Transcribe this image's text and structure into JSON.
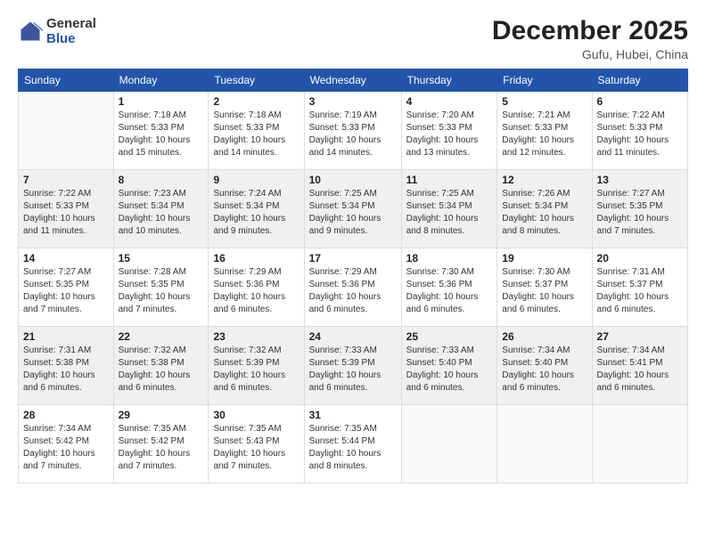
{
  "header": {
    "logo_general": "General",
    "logo_blue": "Blue",
    "month": "December 2025",
    "location": "Gufu, Hubei, China"
  },
  "columns": [
    "Sunday",
    "Monday",
    "Tuesday",
    "Wednesday",
    "Thursday",
    "Friday",
    "Saturday"
  ],
  "weeks": [
    [
      {
        "day": "",
        "info": ""
      },
      {
        "day": "1",
        "info": "Sunrise: 7:18 AM\nSunset: 5:33 PM\nDaylight: 10 hours\nand 15 minutes."
      },
      {
        "day": "2",
        "info": "Sunrise: 7:18 AM\nSunset: 5:33 PM\nDaylight: 10 hours\nand 14 minutes."
      },
      {
        "day": "3",
        "info": "Sunrise: 7:19 AM\nSunset: 5:33 PM\nDaylight: 10 hours\nand 14 minutes."
      },
      {
        "day": "4",
        "info": "Sunrise: 7:20 AM\nSunset: 5:33 PM\nDaylight: 10 hours\nand 13 minutes."
      },
      {
        "day": "5",
        "info": "Sunrise: 7:21 AM\nSunset: 5:33 PM\nDaylight: 10 hours\nand 12 minutes."
      },
      {
        "day": "6",
        "info": "Sunrise: 7:22 AM\nSunset: 5:33 PM\nDaylight: 10 hours\nand 11 minutes."
      }
    ],
    [
      {
        "day": "7",
        "info": "Sunrise: 7:22 AM\nSunset: 5:33 PM\nDaylight: 10 hours\nand 11 minutes."
      },
      {
        "day": "8",
        "info": "Sunrise: 7:23 AM\nSunset: 5:34 PM\nDaylight: 10 hours\nand 10 minutes."
      },
      {
        "day": "9",
        "info": "Sunrise: 7:24 AM\nSunset: 5:34 PM\nDaylight: 10 hours\nand 9 minutes."
      },
      {
        "day": "10",
        "info": "Sunrise: 7:25 AM\nSunset: 5:34 PM\nDaylight: 10 hours\nand 9 minutes."
      },
      {
        "day": "11",
        "info": "Sunrise: 7:25 AM\nSunset: 5:34 PM\nDaylight: 10 hours\nand 8 minutes."
      },
      {
        "day": "12",
        "info": "Sunrise: 7:26 AM\nSunset: 5:34 PM\nDaylight: 10 hours\nand 8 minutes."
      },
      {
        "day": "13",
        "info": "Sunrise: 7:27 AM\nSunset: 5:35 PM\nDaylight: 10 hours\nand 7 minutes."
      }
    ],
    [
      {
        "day": "14",
        "info": "Sunrise: 7:27 AM\nSunset: 5:35 PM\nDaylight: 10 hours\nand 7 minutes."
      },
      {
        "day": "15",
        "info": "Sunrise: 7:28 AM\nSunset: 5:35 PM\nDaylight: 10 hours\nand 7 minutes."
      },
      {
        "day": "16",
        "info": "Sunrise: 7:29 AM\nSunset: 5:36 PM\nDaylight: 10 hours\nand 6 minutes."
      },
      {
        "day": "17",
        "info": "Sunrise: 7:29 AM\nSunset: 5:36 PM\nDaylight: 10 hours\nand 6 minutes."
      },
      {
        "day": "18",
        "info": "Sunrise: 7:30 AM\nSunset: 5:36 PM\nDaylight: 10 hours\nand 6 minutes."
      },
      {
        "day": "19",
        "info": "Sunrise: 7:30 AM\nSunset: 5:37 PM\nDaylight: 10 hours\nand 6 minutes."
      },
      {
        "day": "20",
        "info": "Sunrise: 7:31 AM\nSunset: 5:37 PM\nDaylight: 10 hours\nand 6 minutes."
      }
    ],
    [
      {
        "day": "21",
        "info": "Sunrise: 7:31 AM\nSunset: 5:38 PM\nDaylight: 10 hours\nand 6 minutes."
      },
      {
        "day": "22",
        "info": "Sunrise: 7:32 AM\nSunset: 5:38 PM\nDaylight: 10 hours\nand 6 minutes."
      },
      {
        "day": "23",
        "info": "Sunrise: 7:32 AM\nSunset: 5:39 PM\nDaylight: 10 hours\nand 6 minutes."
      },
      {
        "day": "24",
        "info": "Sunrise: 7:33 AM\nSunset: 5:39 PM\nDaylight: 10 hours\nand 6 minutes."
      },
      {
        "day": "25",
        "info": "Sunrise: 7:33 AM\nSunset: 5:40 PM\nDaylight: 10 hours\nand 6 minutes."
      },
      {
        "day": "26",
        "info": "Sunrise: 7:34 AM\nSunset: 5:40 PM\nDaylight: 10 hours\nand 6 minutes."
      },
      {
        "day": "27",
        "info": "Sunrise: 7:34 AM\nSunset: 5:41 PM\nDaylight: 10 hours\nand 6 minutes."
      }
    ],
    [
      {
        "day": "28",
        "info": "Sunrise: 7:34 AM\nSunset: 5:42 PM\nDaylight: 10 hours\nand 7 minutes."
      },
      {
        "day": "29",
        "info": "Sunrise: 7:35 AM\nSunset: 5:42 PM\nDaylight: 10 hours\nand 7 minutes."
      },
      {
        "day": "30",
        "info": "Sunrise: 7:35 AM\nSunset: 5:43 PM\nDaylight: 10 hours\nand 7 minutes."
      },
      {
        "day": "31",
        "info": "Sunrise: 7:35 AM\nSunset: 5:44 PM\nDaylight: 10 hours\nand 8 minutes."
      },
      {
        "day": "",
        "info": ""
      },
      {
        "day": "",
        "info": ""
      },
      {
        "day": "",
        "info": ""
      }
    ]
  ]
}
